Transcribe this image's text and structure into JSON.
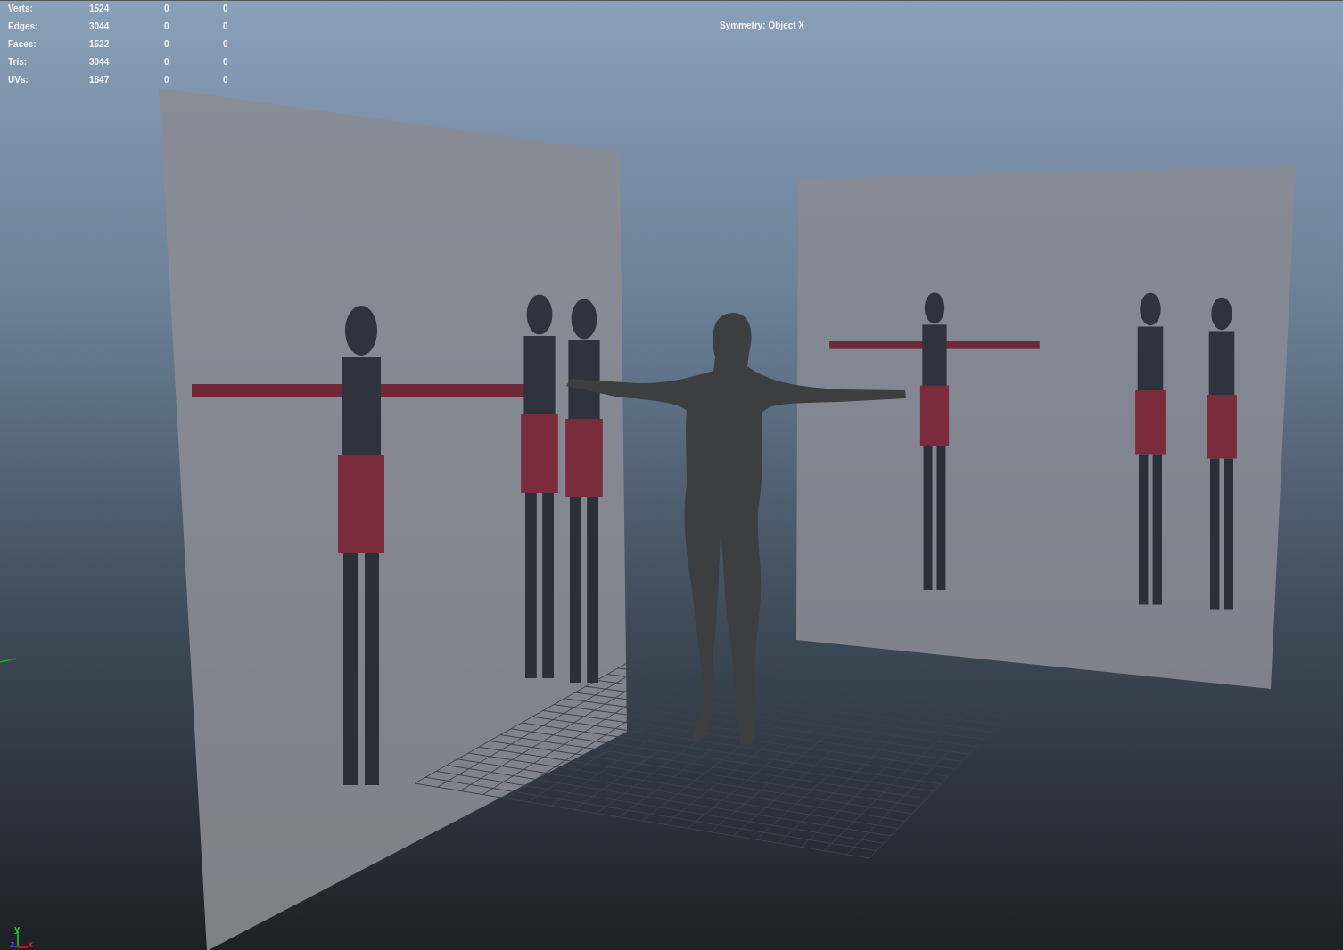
{
  "poly_count": [
    {
      "label": "Verts:",
      "values": [
        "1524",
        "0",
        "0"
      ]
    },
    {
      "label": "Edges:",
      "values": [
        "3044",
        "0",
        "0"
      ]
    },
    {
      "label": "Faces:",
      "values": [
        "1522",
        "0",
        "0"
      ]
    },
    {
      "label": "Tris:",
      "values": [
        "3044",
        "0",
        "0"
      ]
    },
    {
      "label": "UVs:",
      "values": [
        "1847",
        "0",
        "0"
      ]
    }
  ],
  "symmetry": "Symmetry: Object X",
  "axis_labels": {
    "y": "y",
    "z": "z",
    "x": "x"
  }
}
